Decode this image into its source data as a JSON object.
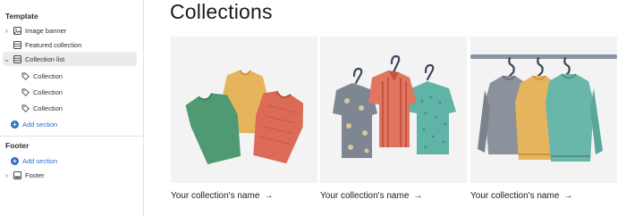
{
  "sidebar": {
    "template_title": "Template",
    "items": [
      {
        "label": "Image banner"
      },
      {
        "label": "Featured collection"
      },
      {
        "label": "Collection list"
      }
    ],
    "children": [
      {
        "label": "Collection"
      },
      {
        "label": "Collection"
      },
      {
        "label": "Collection"
      }
    ],
    "add_section_label": "Add section",
    "footer_title": "Footer",
    "footer_add_label": "Add section",
    "footer_item": "Footer"
  },
  "main": {
    "title": "Collections",
    "cards": [
      {
        "name": "Your collection's name",
        "arrow": "→"
      },
      {
        "name": "Your collection's name",
        "arrow": "→"
      },
      {
        "name": "Your collection's name",
        "arrow": "→"
      }
    ]
  },
  "colors": {
    "accent": "#2c6ecb",
    "card_bg": "#f3f3f3",
    "selected_bg": "#ebebeb"
  }
}
